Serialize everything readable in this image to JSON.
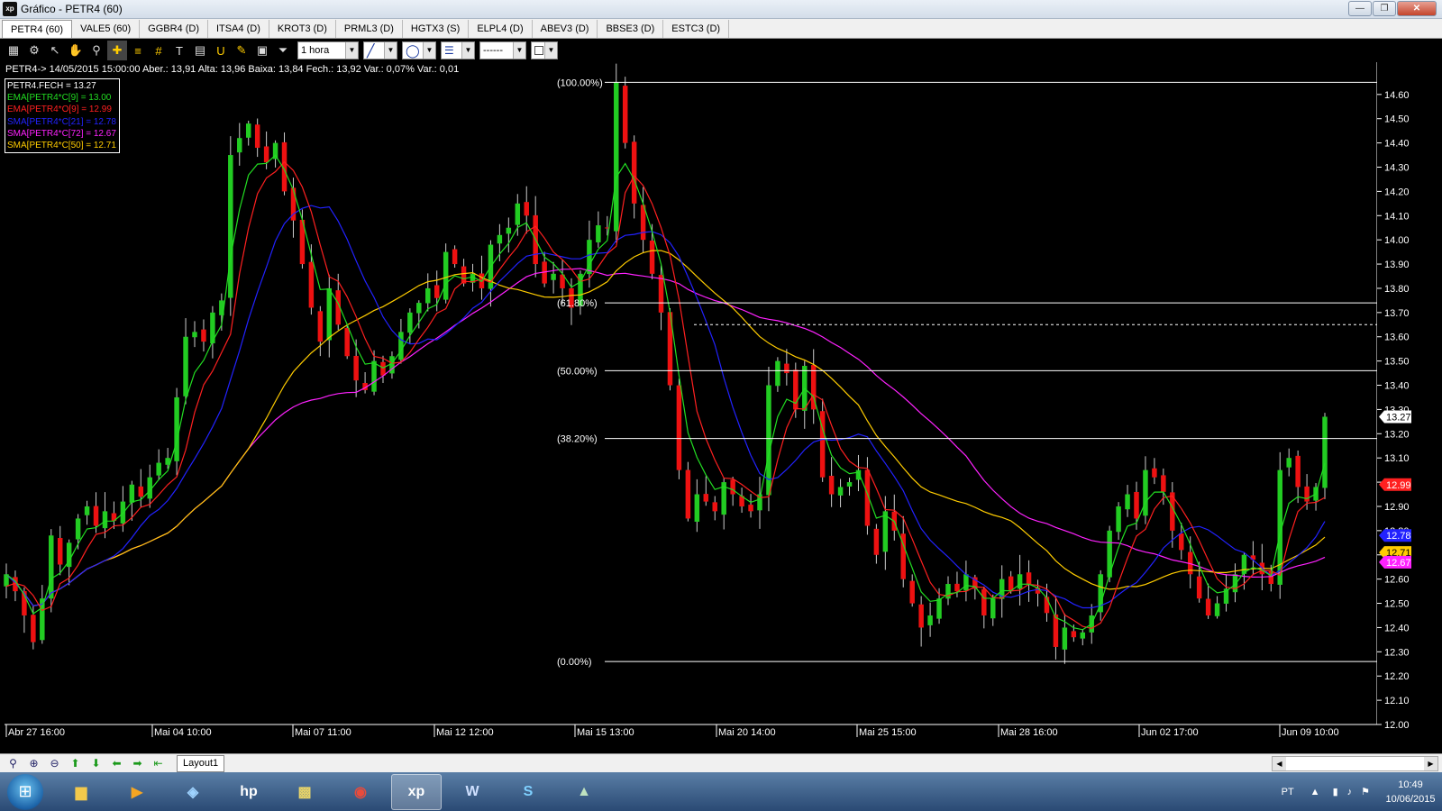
{
  "window": {
    "title": "Gráfico - PETR4 (60)"
  },
  "tabs": [
    {
      "label": "PETR4 (60)",
      "active": true
    },
    {
      "label": "VALE5 (60)"
    },
    {
      "label": "GGBR4 (D)"
    },
    {
      "label": "ITSA4 (D)"
    },
    {
      "label": "KROT3 (D)"
    },
    {
      "label": "PRML3 (D)"
    },
    {
      "label": "HGTX3 (S)"
    },
    {
      "label": "ELPL4 (D)"
    },
    {
      "label": "ABEV3 (D)"
    },
    {
      "label": "BBSE3 (D)"
    },
    {
      "label": "ESTC3 (D)"
    }
  ],
  "toolbar": {
    "timeframe_value": "1 hora",
    "icons": [
      "chart-type-icon",
      "settings-icon",
      "cursor-icon",
      "hand-icon",
      "zoom-tool-icon",
      "crosshair-icon",
      "fibonacci-icon",
      "grid-icon",
      "text-icon",
      "calculator-icon",
      "magnet-icon",
      "brush-icon",
      "clipboard-icon",
      "filter-icon"
    ]
  },
  "info_bar": {
    "text": "PETR4-> 14/05/2015 15:00:00 Aber.: 13,91 Alta: 13,96 Baixa: 13,84 Fech.: 13,92 Var.: 0,07% Var.: 0,01"
  },
  "legend": [
    {
      "text": "PETR4.FECH = 13.27",
      "color": "#ffffff"
    },
    {
      "text": "EMA[PETR4*C[9] = 13.00",
      "color": "#22dd22"
    },
    {
      "text": "EMA[PETR4*O[9] = 12.99",
      "color": "#ff2020"
    },
    {
      "text": "SMA[PETR4*C[21] = 12.78",
      "color": "#2222ff"
    },
    {
      "text": "SMA[PETR4*C[72] = 12.67",
      "color": "#ff22ff"
    },
    {
      "text": "SMA[PETR4*C[50] = 12.71",
      "color": "#ffcc00"
    }
  ],
  "chart_data": {
    "type": "candlestick",
    "symbol": "PETR4",
    "interval": "60",
    "y_ticks": [
      14.6,
      14.5,
      14.4,
      14.3,
      14.2,
      14.1,
      14.0,
      13.9,
      13.8,
      13.7,
      13.6,
      13.5,
      13.4,
      13.3,
      13.2,
      13.1,
      13.0,
      12.9,
      12.8,
      12.7,
      12.6,
      12.5,
      12.4,
      12.3,
      12.2,
      12.1,
      12.0
    ],
    "y_range": [
      12.0,
      14.67
    ],
    "x_labels": [
      "Abr 27 16:00",
      "Mai 04 10:00",
      "Mai 07 11:00",
      "Mai 12 12:00",
      "Mai 15 13:00",
      "Mai 20 14:00",
      "Mai 25 15:00",
      "Mai 28 16:00",
      "Jun 02 17:00",
      "Jun 09 10:00"
    ],
    "fibonacci": {
      "levels": [
        {
          "label": "(100.00%)",
          "price": 14.65
        },
        {
          "label": "(61.80%)",
          "price": 13.74
        },
        {
          "label": "(50.00%)",
          "price": 13.46
        },
        {
          "label": "(38.20%)",
          "price": 13.18
        },
        {
          "label": "(0.00%)",
          "price": 12.26
        }
      ],
      "dashed_line_price": 13.65
    },
    "price_tags": [
      {
        "value": "13.27",
        "price": 13.27,
        "color": "#ffffff",
        "text_color": "#000000"
      },
      {
        "value": "12.99",
        "price": 12.99,
        "color": "#ff2020",
        "text_color": "#ffffff"
      },
      {
        "value": "12.78",
        "price": 12.78,
        "color": "#2222ff",
        "text_color": "#ffffff"
      },
      {
        "value": "12.71",
        "price": 12.71,
        "color": "#ffcc00",
        "text_color": "#000000"
      },
      {
        "value": "12.67",
        "price": 12.67,
        "color": "#ff22ff",
        "text_color": "#ffffff"
      }
    ],
    "closes": [
      12.62,
      12.55,
      12.45,
      12.34,
      12.52,
      12.78,
      12.66,
      12.75,
      12.85,
      12.9,
      12.82,
      12.88,
      12.84,
      12.92,
      12.99,
      12.94,
      13.02,
      13.08,
      13.1,
      13.35,
      13.6,
      13.62,
      13.58,
      13.7,
      13.75,
      14.35,
      14.42,
      14.48,
      14.38,
      14.32,
      14.4,
      14.2,
      14.08,
      13.9,
      13.72,
      13.58,
      13.8,
      13.65,
      13.52,
      13.42,
      13.38,
      13.5,
      13.44,
      13.52,
      13.62,
      13.7,
      13.74,
      13.8,
      13.76,
      13.95,
      13.9,
      13.82,
      13.86,
      13.8,
      13.98,
      14.02,
      14.05,
      14.15,
      14.1,
      13.9,
      13.82,
      13.86,
      13.8,
      13.72,
      13.86,
      14.0,
      14.06,
      14.05,
      14.65,
      14.4,
      14.15,
      14.0,
      13.86,
      13.7,
      13.4,
      13.05,
      12.85,
      12.95,
      12.92,
      12.88,
      13.0,
      12.95,
      12.9,
      12.88,
      12.95,
      13.4,
      13.5,
      13.45,
      13.3,
      13.48,
      13.3,
      13.02,
      12.95,
      12.98,
      13.0,
      13.05,
      12.82,
      12.7,
      12.88,
      12.8,
      12.6,
      12.5,
      12.4,
      12.45,
      12.52,
      12.58,
      12.55,
      12.62,
      12.56,
      12.45,
      12.52,
      12.6,
      12.55,
      12.62,
      12.58,
      12.54,
      12.46,
      12.32,
      12.4,
      12.36,
      12.38,
      12.45,
      12.62,
      12.8,
      12.9,
      12.95,
      12.85,
      13.05,
      13.02,
      12.96,
      12.8,
      12.72,
      12.62,
      12.52,
      12.45,
      12.5,
      12.56,
      12.62,
      12.7,
      12.68,
      12.62,
      12.58,
      13.05,
      13.1,
      12.98,
      12.92,
      12.98,
      13.27
    ],
    "series": [
      {
        "name": "EMA[PETR4*C[9]",
        "color": "#22dd22",
        "period": 9
      },
      {
        "name": "EMA[PETR4*O[9]",
        "color": "#ff2020",
        "period": 9
      },
      {
        "name": "SMA[PETR4*C[21]",
        "color": "#2222ff",
        "period": 21
      },
      {
        "name": "SMA[PETR4*C[72]",
        "color": "#ff22ff",
        "period": 72
      },
      {
        "name": "SMA[PETR4*C[50]",
        "color": "#ffcc00",
        "period": 50
      }
    ]
  },
  "bottom_bar": {
    "layout_tab": "Layout1",
    "icons": [
      "zoom-fit-icon",
      "zoom-in-icon",
      "zoom-out-icon",
      "up-arrow-icon",
      "down-arrow-icon",
      "left-arrow-icon",
      "right-arrow-icon",
      "left-end-icon"
    ]
  },
  "taskbar": {
    "apps": [
      "explorer",
      "media-player",
      "network",
      "hp",
      "tools",
      "chrome",
      "xp",
      "word",
      "skype",
      "photos"
    ],
    "language": "PT",
    "time": "10:49",
    "date": "10/06/2015"
  }
}
